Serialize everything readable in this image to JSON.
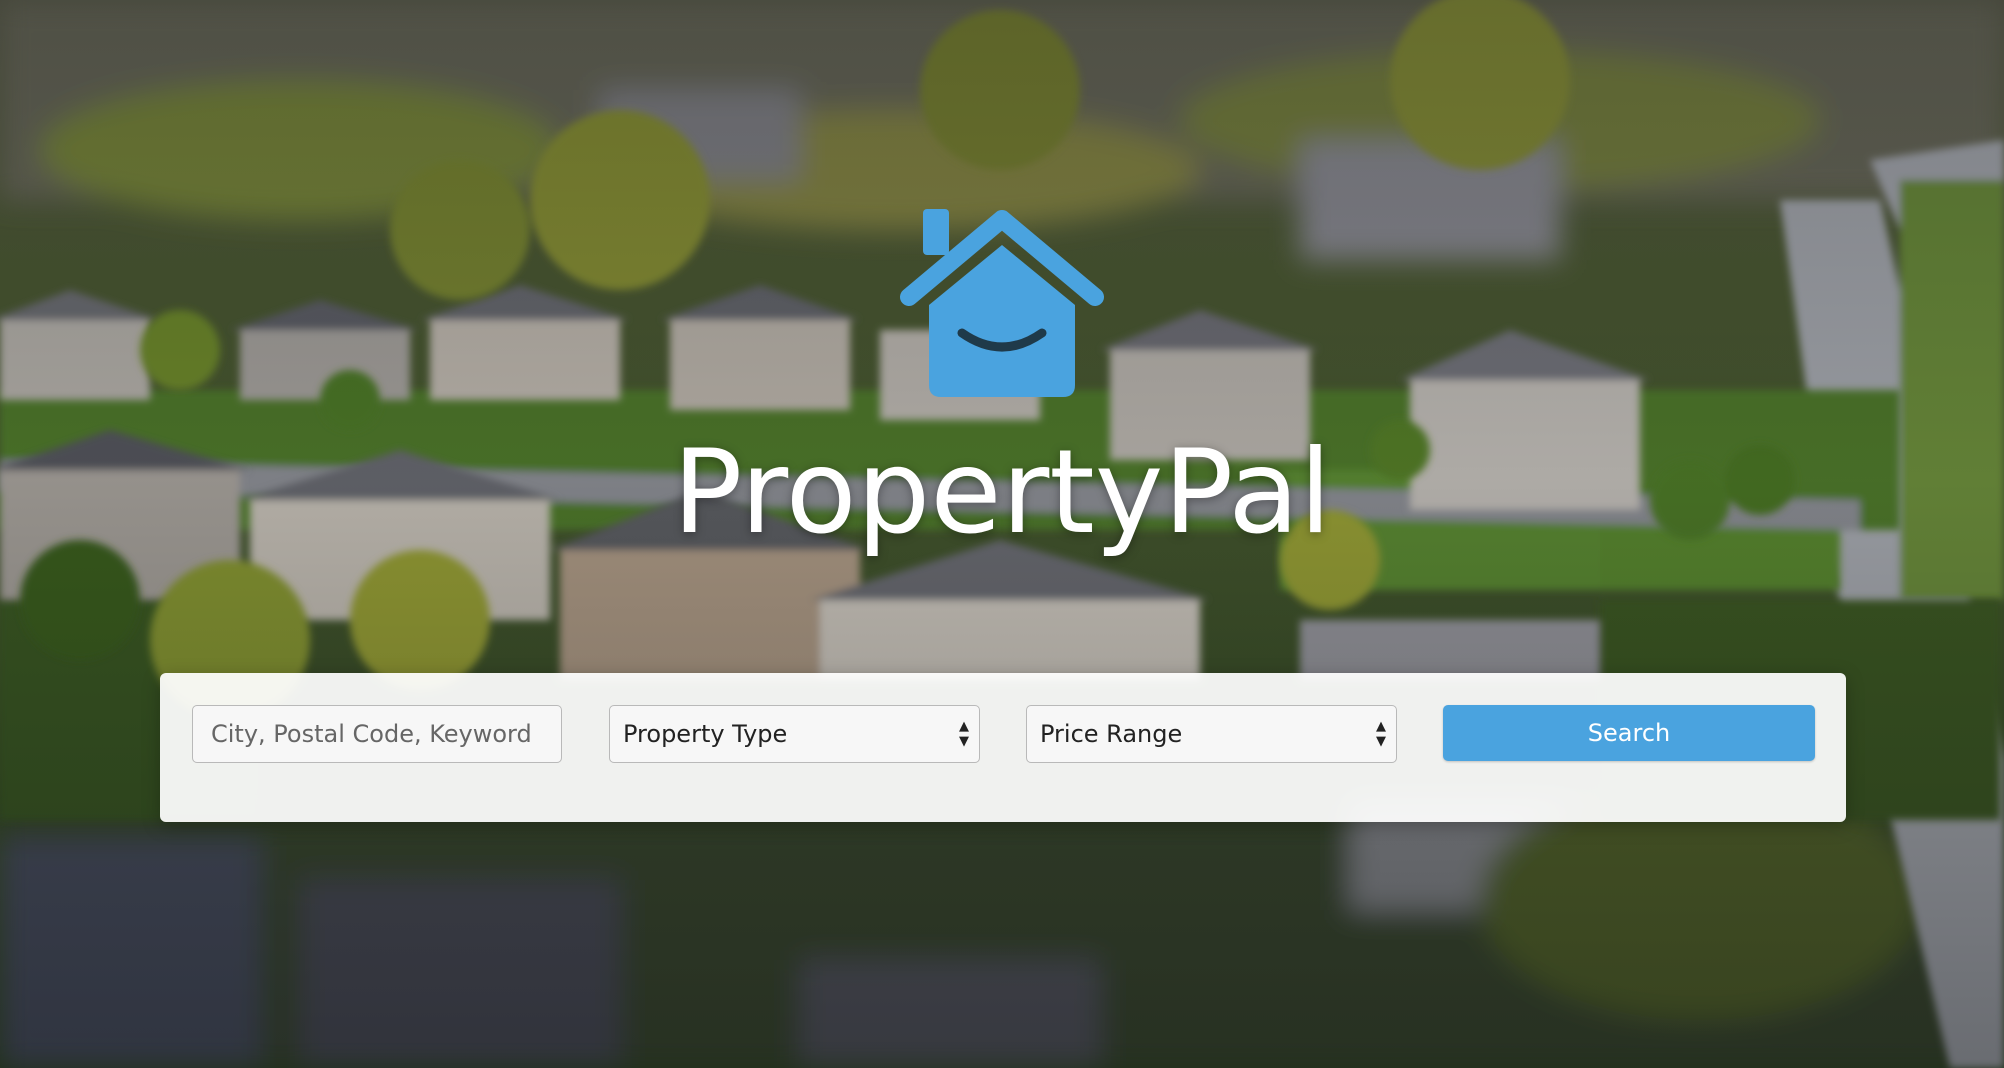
{
  "brand": {
    "name": "PropertyPal",
    "logo_icon": "house-smile-icon",
    "accent_color": "#4aa3df"
  },
  "search": {
    "keyword_placeholder": "City, Postal Code, Keyword",
    "keyword_value": "",
    "property_type": {
      "selected": "Property Type"
    },
    "price_range": {
      "selected": "Price Range"
    },
    "button_label": "Search"
  },
  "background": {
    "description_icon": "aerial-suburb-photo"
  }
}
